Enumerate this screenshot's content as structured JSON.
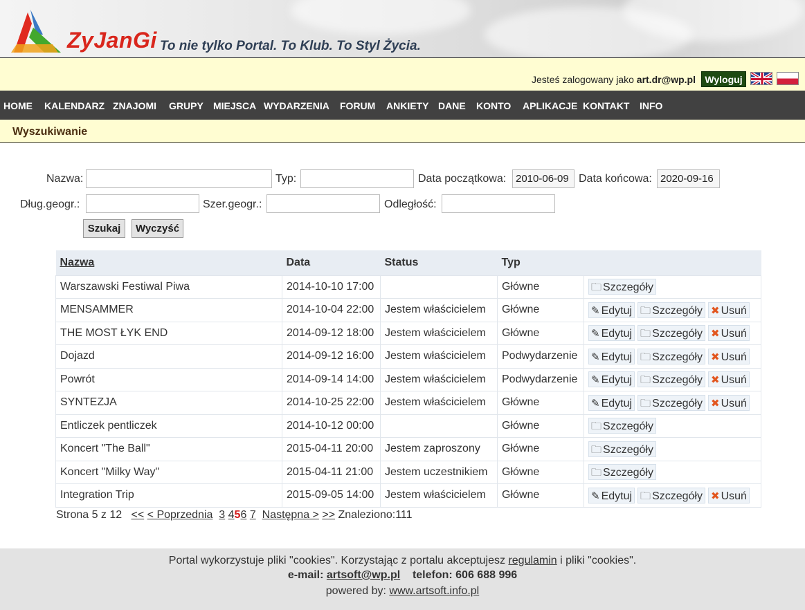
{
  "header": {
    "logo_text": "ZyJanGi",
    "tagline": "To nie tylko Portal. To Klub. To Styl Życia."
  },
  "login": {
    "prefix": "Jesteś zalogowany jako",
    "user": "art.dr@wp.pl",
    "logout_label": "Wyloguj"
  },
  "nav": [
    "HOME",
    "KALENDARZ",
    "ZNAJOMI",
    "GRUPY",
    "MIEJSCA",
    "WYDARZENIA",
    "FORUM",
    "ANKIETY",
    "DANE",
    "KONTO",
    "APLIKACJE",
    "KONTAKT",
    "INFO"
  ],
  "section_title": "Wyszukiwanie",
  "form": {
    "name_label": "Nazwa:",
    "name_value": "",
    "type_label": "Typ:",
    "type_value": "",
    "start_label": "Data początkowa:",
    "start_value": "2010-06-09",
    "end_label": "Data końcowa:",
    "end_value": "2020-09-16",
    "lon_label": "Dług.geogr.:",
    "lon_value": "",
    "lat_label": "Szer.geogr.:",
    "lat_value": "",
    "dist_label": "Odległość:",
    "dist_value": "",
    "search_label": "Szukaj",
    "clear_label": "Wyczyść"
  },
  "table": {
    "headers": [
      "Nazwa",
      "Data",
      "Status",
      "Typ",
      ""
    ],
    "action_labels": {
      "edit": "Edytuj",
      "details": "Szczegóły",
      "delete": "Usuń"
    },
    "rows": [
      {
        "name": "Warszawski Festiwal Piwa",
        "date": "2014-10-10 17:00",
        "status": "",
        "type": "Główne",
        "owner": false
      },
      {
        "name": "MENSAMMER",
        "date": "2014-10-04 22:00",
        "status": "Jestem właścicielem",
        "type": "Główne",
        "owner": true
      },
      {
        "name": "THE MOST ŁYK END",
        "date": "2014-09-12 18:00",
        "status": "Jestem właścicielem",
        "type": "Główne",
        "owner": true
      },
      {
        "name": "Dojazd",
        "date": "2014-09-12 16:00",
        "status": "Jestem właścicielem",
        "type": "Podwydarzenie",
        "owner": true
      },
      {
        "name": "Powrót",
        "date": "2014-09-14 14:00",
        "status": "Jestem właścicielem",
        "type": "Podwydarzenie",
        "owner": true
      },
      {
        "name": "SYNTEZJA",
        "date": "2014-10-25 22:00",
        "status": "Jestem właścicielem",
        "type": "Główne",
        "owner": true
      },
      {
        "name": "Entliczek pentliczek",
        "date": "2014-10-12 00:00",
        "status": "",
        "type": "Główne",
        "owner": false
      },
      {
        "name": "Koncert \"The Ball\"",
        "date": "2015-04-11 20:00",
        "status": "Jestem zaproszony",
        "type": "Główne",
        "owner": false
      },
      {
        "name": "Koncert \"Milky Way\"",
        "date": "2015-04-11 21:00",
        "status": "Jestem uczestnikiem",
        "type": "Główne",
        "owner": false
      },
      {
        "name": "Integration Trip",
        "date": "2015-09-05 14:00",
        "status": "Jestem właścicielem",
        "type": "Główne",
        "owner": true
      }
    ]
  },
  "pager": {
    "page_info": "Strona 5 z 12",
    "first": "<<",
    "prev": "< Poprzednia",
    "pages": [
      "3",
      "4",
      "5",
      "6",
      "7"
    ],
    "current": "5",
    "next": "Następna >",
    "last": ">>",
    "found": "Znaleziono:111"
  },
  "footer": {
    "cookies_text_1": "Portal wykorzystuje pliki \"cookies\". Korzystając z portalu akceptujesz",
    "cookies_link": "regulamin",
    "cookies_text_2": "i pliki \"cookies\".",
    "email_label": "e-mail:",
    "email": "artsoft@wp.pl",
    "phone": "telefon: 606 688 996",
    "powered_label": "powered by:",
    "powered_link": "www.artsoft.info.pl"
  }
}
